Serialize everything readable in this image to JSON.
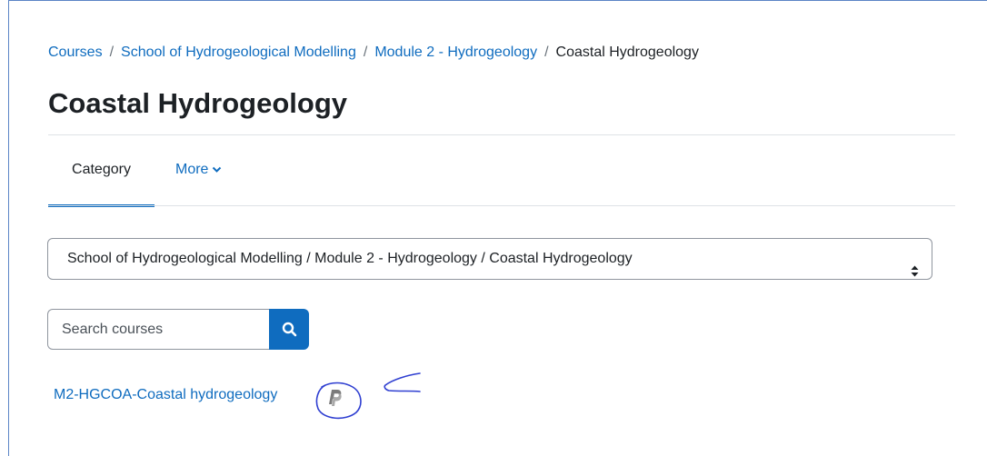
{
  "breadcrumb": {
    "items": [
      "Courses",
      "School of Hydrogeological Modelling",
      "Module 2 - Hydrogeology"
    ],
    "current": "Coastal Hydrogeology",
    "separator": "/"
  },
  "page": {
    "title": "Coastal Hydrogeology"
  },
  "nav": {
    "tabs": [
      {
        "label": "Category",
        "active": true
      },
      {
        "label": "More",
        "icon": "chevron-down-icon"
      }
    ]
  },
  "category_select": {
    "selected": "School of Hydrogeological Modelling / Module 2 - Hydrogeology / Coastal Hydrogeology",
    "icon": "sort-updown-icon"
  },
  "search": {
    "placeholder": "Search courses",
    "value": "",
    "button_icon": "search-icon"
  },
  "courses": [
    {
      "name": "M2-HGCOA-Coastal hydrogeology",
      "enrol_icon": "paypal-icon"
    }
  ],
  "colors": {
    "link": "#0f6cbf",
    "text": "#1d2125",
    "border": "#8f959e",
    "annotation": "#2f3fd1"
  }
}
